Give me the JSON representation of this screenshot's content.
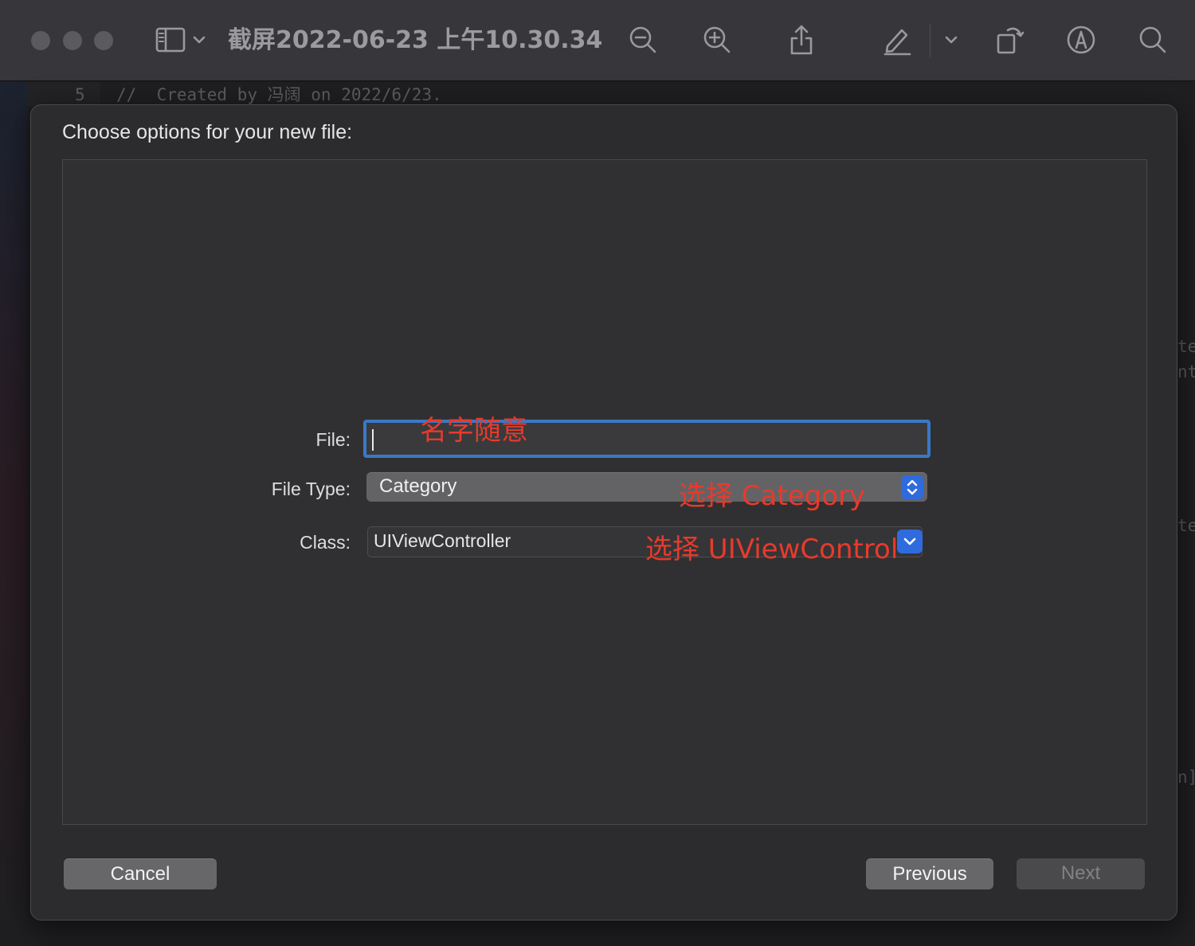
{
  "window": {
    "title": "截屏2022-06-23 上午10.30.34"
  },
  "editor": {
    "line_number": "5",
    "code_line": "//  Created by 冯阔 on 2022/6/23.",
    "side_fragments": [
      "te",
      "nt",
      "te",
      "n]"
    ]
  },
  "sheet": {
    "title": "Choose options for your new file:",
    "file_label": "File:",
    "file_value": "",
    "file_type_label": "File Type:",
    "file_type_value": "Category",
    "class_label": "Class:",
    "class_value": "UIViewController",
    "buttons": {
      "cancel": "Cancel",
      "previous": "Previous",
      "next": "Next"
    }
  },
  "annotations": {
    "name_hint": "名字随意",
    "type_hint": "选择 Category",
    "class_hint": "选择 UIViewControl"
  },
  "colors": {
    "accent": "#2f6bdc",
    "focus_ring": "#3a78c8",
    "annotation": "#e83a2c"
  },
  "icons": [
    "sidebar-toggle-icon",
    "chevron-down-icon",
    "zoom-out-icon",
    "zoom-in-icon",
    "share-icon",
    "markup-pen-icon",
    "rotate-icon",
    "annotate-icon",
    "search-icon"
  ]
}
